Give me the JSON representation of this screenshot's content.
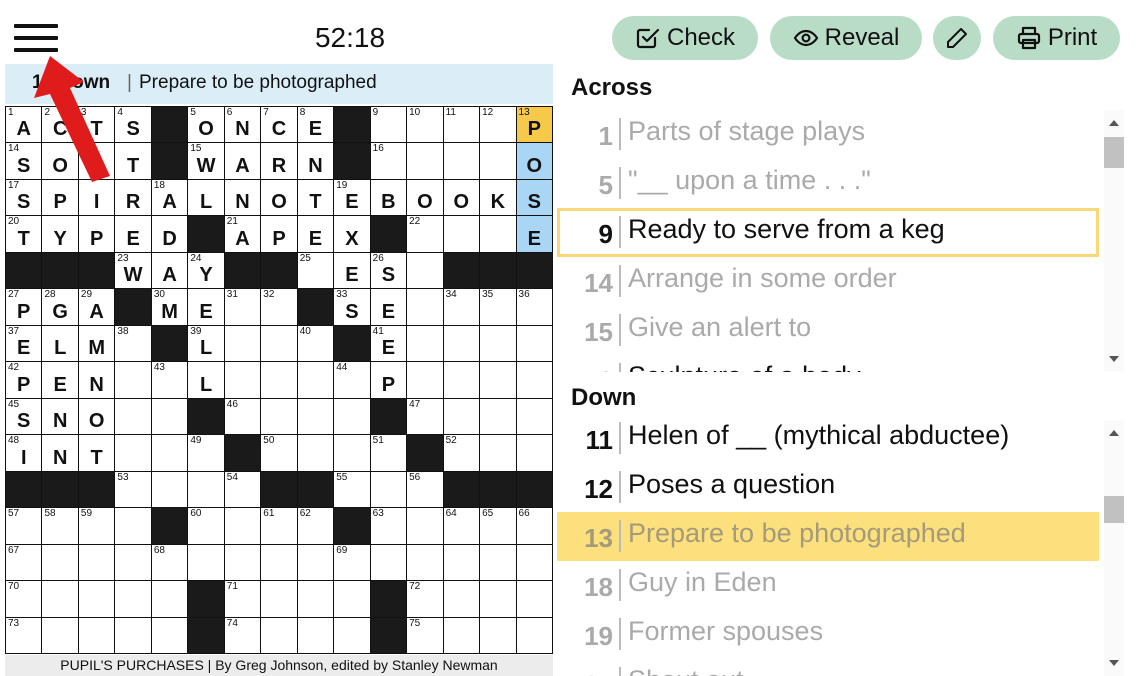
{
  "header": {
    "timer": "52:18",
    "buttons": {
      "check": {
        "label": "Check",
        "icon": "checkbox-icon"
      },
      "reveal": {
        "label": "Reveal",
        "icon": "eye-icon"
      },
      "pencil": {
        "icon": "pencil-icon"
      },
      "print": {
        "label": "Print",
        "icon": "printer-icon"
      }
    }
  },
  "current_clue": {
    "number": "13 Down",
    "separator": "|",
    "text": "Prepare to be photographed"
  },
  "grid": {
    "size": 15,
    "colors": {
      "selected": "#f6c94a",
      "word": "#a9d6f4",
      "block": "#1a1a1a"
    },
    "rows": [
      "ACTS#ONCE#...P",
      "SORT#WARN#...O",
      "SPIRALNOTEBOOKS",
      "TYPED#APEX#...E",
      "###WAY##.ES.###",
      "PGA#ME..#SE....",
      "ELM##L...#E....",
      "PEN..L...P.....",
      "SNO..#....#....",
      "INT...#...#....",
      "###.......#..##",
      "....#....#.....",
      ".....#.........",
      "......#...#....",
      "......#...#...."
    ],
    "blocks": [
      [
        0,
        4
      ],
      [
        0,
        9
      ],
      [
        1,
        4
      ],
      [
        1,
        9
      ],
      [
        3,
        5
      ],
      [
        3,
        10
      ],
      [
        4,
        0
      ],
      [
        4,
        1
      ],
      [
        4,
        2
      ],
      [
        4,
        6
      ],
      [
        4,
        7
      ],
      [
        4,
        12
      ],
      [
        4,
        13
      ],
      [
        4,
        14
      ],
      [
        5,
        3
      ],
      [
        5,
        8
      ],
      [
        6,
        4
      ],
      [
        6,
        9
      ],
      [
        8,
        5
      ],
      [
        8,
        10
      ],
      [
        9,
        6
      ],
      [
        9,
        11
      ],
      [
        10,
        0
      ],
      [
        10,
        1
      ],
      [
        10,
        2
      ],
      [
        10,
        7
      ],
      [
        10,
        8
      ],
      [
        10,
        12
      ],
      [
        10,
        13
      ],
      [
        10,
        14
      ],
      [
        11,
        4
      ],
      [
        11,
        9
      ],
      [
        13,
        5
      ],
      [
        13,
        10
      ],
      [
        14,
        5
      ],
      [
        14,
        10
      ]
    ],
    "selected": [
      0,
      14
    ],
    "word_cells": [
      [
        1,
        14
      ],
      [
        2,
        14
      ],
      [
        3,
        14
      ]
    ],
    "numbers": [
      [
        0,
        0,
        "1"
      ],
      [
        0,
        1,
        "2"
      ],
      [
        0,
        2,
        "3"
      ],
      [
        0,
        3,
        "4"
      ],
      [
        0,
        5,
        "5"
      ],
      [
        0,
        6,
        "6"
      ],
      [
        0,
        7,
        "7"
      ],
      [
        0,
        8,
        "8"
      ],
      [
        0,
        10,
        "9"
      ],
      [
        0,
        11,
        "10"
      ],
      [
        0,
        12,
        "11"
      ],
      [
        0,
        13,
        "12"
      ],
      [
        0,
        14,
        "13"
      ],
      [
        1,
        0,
        "14"
      ],
      [
        1,
        5,
        "15"
      ],
      [
        1,
        10,
        "16"
      ],
      [
        2,
        0,
        "17"
      ],
      [
        2,
        4,
        "18"
      ],
      [
        2,
        9,
        "19"
      ],
      [
        3,
        0,
        "20"
      ],
      [
        3,
        6,
        "21"
      ],
      [
        3,
        11,
        "22"
      ],
      [
        4,
        3,
        "23"
      ],
      [
        4,
        5,
        "24"
      ],
      [
        4,
        8,
        "25"
      ],
      [
        4,
        10,
        "26"
      ],
      [
        5,
        0,
        "27"
      ],
      [
        5,
        1,
        "28"
      ],
      [
        5,
        2,
        "29"
      ],
      [
        5,
        4,
        "30"
      ],
      [
        5,
        6,
        "31"
      ],
      [
        5,
        7,
        "32"
      ],
      [
        5,
        9,
        "33"
      ],
      [
        5,
        12,
        "34"
      ],
      [
        5,
        13,
        "35"
      ],
      [
        5,
        14,
        "36"
      ],
      [
        6,
        0,
        "37"
      ],
      [
        6,
        3,
        "38"
      ],
      [
        6,
        5,
        "39"
      ],
      [
        6,
        8,
        "40"
      ],
      [
        6,
        10,
        "41"
      ],
      [
        7,
        0,
        "42"
      ],
      [
        7,
        4,
        "43"
      ],
      [
        7,
        9,
        "44"
      ],
      [
        8,
        0,
        "45"
      ],
      [
        8,
        6,
        "46"
      ],
      [
        8,
        11,
        "47"
      ],
      [
        9,
        0,
        "48"
      ],
      [
        9,
        5,
        "49"
      ],
      [
        9,
        7,
        "50"
      ],
      [
        9,
        10,
        "51"
      ],
      [
        9,
        12,
        "52"
      ],
      [
        10,
        3,
        "53"
      ],
      [
        10,
        6,
        "54"
      ],
      [
        10,
        9,
        "55"
      ],
      [
        10,
        11,
        "56"
      ],
      [
        11,
        0,
        "57"
      ],
      [
        11,
        1,
        "58"
      ],
      [
        11,
        2,
        "59"
      ],
      [
        11,
        5,
        "60"
      ],
      [
        11,
        7,
        "61"
      ],
      [
        11,
        8,
        "62"
      ],
      [
        11,
        10,
        "63"
      ],
      [
        11,
        12,
        "64"
      ],
      [
        11,
        13,
        "65"
      ],
      [
        11,
        14,
        "66"
      ],
      [
        12,
        0,
        "67"
      ],
      [
        12,
        4,
        "68"
      ],
      [
        12,
        9,
        "69"
      ],
      [
        13,
        0,
        "70"
      ],
      [
        13,
        6,
        "71"
      ],
      [
        13,
        11,
        "72"
      ],
      [
        14,
        0,
        "73"
      ],
      [
        14,
        6,
        "74"
      ],
      [
        14,
        11,
        "75"
      ]
    ],
    "letters": [
      [
        0,
        0,
        "A"
      ],
      [
        0,
        1,
        "C"
      ],
      [
        0,
        2,
        "T"
      ],
      [
        0,
        3,
        "S"
      ],
      [
        0,
        5,
        "O"
      ],
      [
        0,
        6,
        "N"
      ],
      [
        0,
        7,
        "C"
      ],
      [
        0,
        8,
        "E"
      ],
      [
        0,
        14,
        "P"
      ],
      [
        1,
        0,
        "S"
      ],
      [
        1,
        1,
        "O"
      ],
      [
        1,
        2,
        "R"
      ],
      [
        1,
        3,
        "T"
      ],
      [
        1,
        5,
        "W"
      ],
      [
        1,
        6,
        "A"
      ],
      [
        1,
        7,
        "R"
      ],
      [
        1,
        8,
        "N"
      ],
      [
        1,
        14,
        "O"
      ],
      [
        2,
        0,
        "S"
      ],
      [
        2,
        1,
        "P"
      ],
      [
        2,
        2,
        "I"
      ],
      [
        2,
        3,
        "R"
      ],
      [
        2,
        4,
        "A"
      ],
      [
        2,
        5,
        "L"
      ],
      [
        2,
        6,
        "N"
      ],
      [
        2,
        7,
        "O"
      ],
      [
        2,
        8,
        "T"
      ],
      [
        2,
        9,
        "E"
      ],
      [
        2,
        10,
        "B"
      ],
      [
        2,
        11,
        "O"
      ],
      [
        2,
        12,
        "O"
      ],
      [
        2,
        13,
        "K"
      ],
      [
        2,
        14,
        "S"
      ],
      [
        3,
        0,
        "T"
      ],
      [
        3,
        1,
        "Y"
      ],
      [
        3,
        2,
        "P"
      ],
      [
        3,
        3,
        "E"
      ],
      [
        3,
        4,
        "D"
      ],
      [
        3,
        6,
        "A"
      ],
      [
        3,
        7,
        "P"
      ],
      [
        3,
        8,
        "E"
      ],
      [
        3,
        9,
        "X"
      ],
      [
        3,
        14,
        "E"
      ],
      [
        4,
        3,
        "W"
      ],
      [
        4,
        4,
        "A"
      ],
      [
        4,
        5,
        "Y"
      ],
      [
        4,
        9,
        "E"
      ],
      [
        4,
        10,
        "S"
      ],
      [
        5,
        0,
        "P"
      ],
      [
        5,
        1,
        "G"
      ],
      [
        5,
        2,
        "A"
      ],
      [
        5,
        4,
        "M"
      ],
      [
        5,
        5,
        "E"
      ],
      [
        5,
        9,
        "S"
      ],
      [
        5,
        10,
        "E"
      ],
      [
        6,
        0,
        "E"
      ],
      [
        6,
        1,
        "L"
      ],
      [
        6,
        2,
        "M"
      ],
      [
        6,
        5,
        "L"
      ],
      [
        6,
        10,
        "E"
      ],
      [
        7,
        0,
        "P"
      ],
      [
        7,
        1,
        "E"
      ],
      [
        7,
        2,
        "N"
      ],
      [
        7,
        5,
        "L"
      ],
      [
        7,
        10,
        "P"
      ],
      [
        8,
        0,
        "S"
      ],
      [
        8,
        1,
        "N"
      ],
      [
        8,
        2,
        "O"
      ],
      [
        9,
        0,
        "I"
      ],
      [
        9,
        1,
        "N"
      ],
      [
        9,
        2,
        "T"
      ]
    ]
  },
  "byline": "PUPIL'S PURCHASES | By Greg Johnson, edited by Stanley Newman",
  "across": {
    "heading": "Across",
    "clues": [
      {
        "num": "1",
        "text": "Parts of stage plays",
        "state": "done"
      },
      {
        "num": "5",
        "text": "\"__ upon a time . . .\"",
        "state": "done"
      },
      {
        "num": "9",
        "text": "Ready to serve from a keg",
        "state": "active"
      },
      {
        "num": "14",
        "text": "Arrange in some order",
        "state": "done"
      },
      {
        "num": "15",
        "text": "Give an alert to",
        "state": "done"
      },
      {
        "num": "16",
        "text": "Sculpture of a body",
        "state": "normal"
      }
    ]
  },
  "down": {
    "heading": "Down",
    "clues": [
      {
        "num": "11",
        "text": "Helen of __ (mythical abductee)",
        "state": "normal"
      },
      {
        "num": "12",
        "text": "Poses a question",
        "state": "normal"
      },
      {
        "num": "13",
        "text": "Prepare to be photographed",
        "state": "cross"
      },
      {
        "num": "18",
        "text": "Guy in Eden",
        "state": "done"
      },
      {
        "num": "19",
        "text": "Former spouses",
        "state": "done"
      },
      {
        "num": "21",
        "text": "Shout out",
        "state": "done"
      }
    ]
  }
}
